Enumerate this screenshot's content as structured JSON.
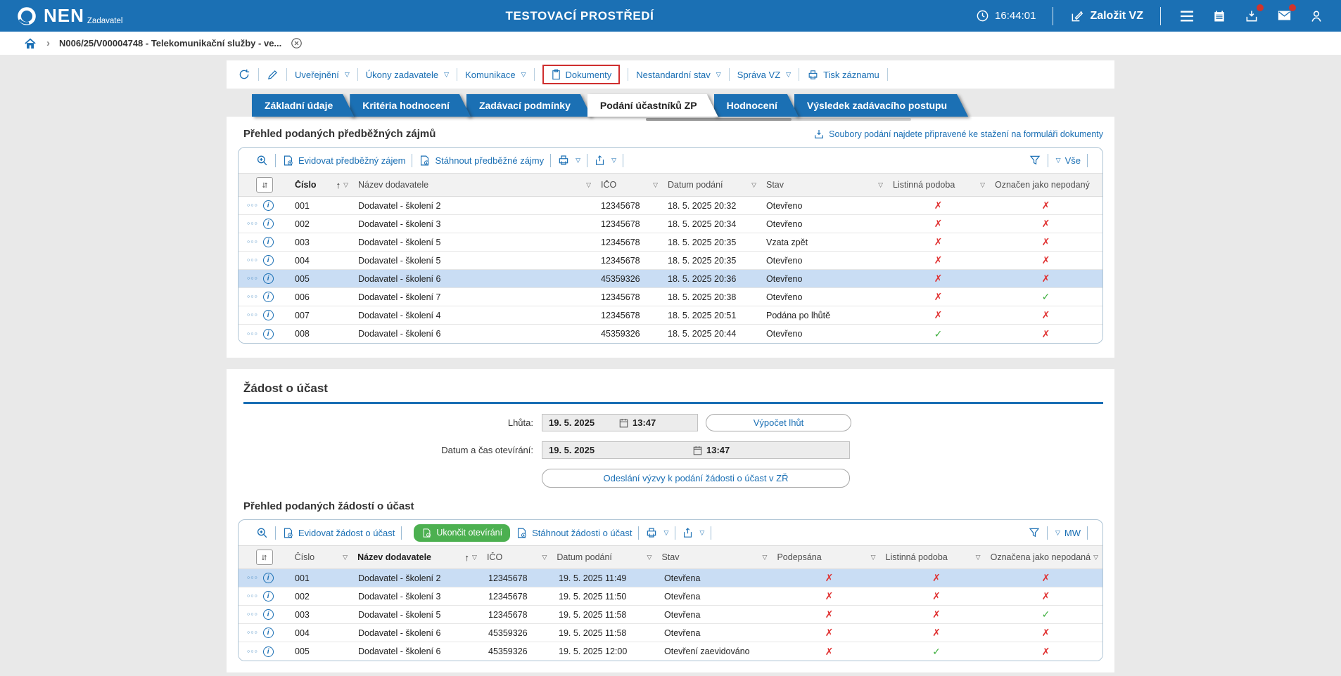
{
  "topbar": {
    "brand": "NEN",
    "brand_sub": "Zadavatel",
    "title": "TESTOVACÍ PROSTŘEDÍ",
    "time": "16:44:01",
    "create_vz": "Založit VZ"
  },
  "breadcrumb": {
    "item": "N006/25/V00004748 - Telekomunikační služby - ve..."
  },
  "action_bar": {
    "uverejneni": "Uveřejnění",
    "ukony_zadavatele": "Úkony zadavatele",
    "komunikace": "Komunikace",
    "dokumenty": "Dokumenty",
    "nestandardni_stav": "Nestandardní stav",
    "sprava_vz": "Správa VZ",
    "tisk_zaznamu": "Tisk záznamu"
  },
  "tabs": [
    {
      "label": "Základní údaje"
    },
    {
      "label": "Kritéria hodnocení"
    },
    {
      "label": "Zadávací podmínky"
    },
    {
      "label": "Podání účastníků ZP",
      "active": true
    },
    {
      "label": "Hodnocení"
    },
    {
      "label": "Výsledek zadávacího postupu"
    }
  ],
  "section1": {
    "title": "Přehled podaných předběžných zájmů",
    "download_note": "Soubory podání najdete připravené ke stažení na formuláři dokumenty",
    "toolbar": {
      "evidovat": "Evidovat předběžný zájem",
      "stahnout": "Stáhnout předběžné zájmy",
      "filter_value": "Vše"
    },
    "table": {
      "columns": [
        "Číslo",
        "Název dodavatele",
        "IČO",
        "Datum podání",
        "Stav",
        "Listinná podoba",
        "Označen jako nepodaný"
      ],
      "rows": [
        {
          "cislo": "001",
          "nazev": "Dodavatel - školení 2",
          "ico": "12345678",
          "datum": "18. 5. 2025 20:32",
          "stav": "Otevřeno",
          "listinna": false,
          "nepodana": false
        },
        {
          "cislo": "002",
          "nazev": "Dodavatel - školení 3",
          "ico": "12345678",
          "datum": "18. 5. 2025 20:34",
          "stav": "Otevřeno",
          "listinna": false,
          "nepodana": false
        },
        {
          "cislo": "003",
          "nazev": "Dodavatel - školení 5",
          "ico": "12345678",
          "datum": "18. 5. 2025 20:35",
          "stav": "Vzata zpět",
          "listinna": false,
          "nepodana": false
        },
        {
          "cislo": "004",
          "nazev": "Dodavatel - školení 5",
          "ico": "12345678",
          "datum": "18. 5. 2025 20:35",
          "stav": "Otevřeno",
          "listinna": false,
          "nepodana": false
        },
        {
          "cislo": "005",
          "nazev": "Dodavatel - školení 6",
          "ico": "45359326",
          "datum": "18. 5. 2025 20:36",
          "stav": "Otevřeno",
          "listinna": false,
          "nepodana": false,
          "selected": true
        },
        {
          "cislo": "006",
          "nazev": "Dodavatel - školení 7",
          "ico": "12345678",
          "datum": "18. 5. 2025 20:38",
          "stav": "Otevřeno",
          "listinna": false,
          "nepodana": true
        },
        {
          "cislo": "007",
          "nazev": "Dodavatel - školení 4",
          "ico": "12345678",
          "datum": "18. 5. 2025 20:51",
          "stav": "Podána po lhůtě",
          "listinna": false,
          "nepodana": false
        },
        {
          "cislo": "008",
          "nazev": "Dodavatel - školení 6",
          "ico": "45359326",
          "datum": "18. 5. 2025 20:44",
          "stav": "Otevřeno",
          "listinna": true,
          "nepodana": false
        }
      ]
    }
  },
  "zadost": {
    "title": "Žádost o účast",
    "lhuta_label": "Lhůta:",
    "lhuta_date": "19. 5. 2025",
    "lhuta_time": "13:47",
    "vypocet_lhut": "Výpočet lhůt",
    "otevirani_label": "Datum a čas otevírání:",
    "otevirani_date": "19. 5. 2025",
    "otevirani_time": "13:47",
    "odeslani_vyzvy": "Odeslání výzvy k podání žádosti o účast v ZŘ"
  },
  "section2": {
    "title": "Přehled podaných žádostí o účast",
    "toolbar": {
      "evidovat": "Evidovat žádost o účast",
      "ukoncit": "Ukončit otevírání",
      "stahnout": "Stáhnout žádosti o účast",
      "filter_value": "MW"
    },
    "table": {
      "columns": [
        "Číslo",
        "Název dodavatele",
        "IČO",
        "Datum podání",
        "Stav",
        "Podepsána",
        "Listinná podoba",
        "Označena jako nepodaná"
      ],
      "rows": [
        {
          "cislo": "001",
          "nazev": "Dodavatel - školení 2",
          "ico": "12345678",
          "datum": "19. 5. 2025 11:49",
          "stav": "Otevřena",
          "podepsana": false,
          "listinna": false,
          "nepodana": false,
          "selected": true
        },
        {
          "cislo": "002",
          "nazev": "Dodavatel - školení 3",
          "ico": "12345678",
          "datum": "19. 5. 2025 11:50",
          "stav": "Otevřena",
          "podepsana": false,
          "listinna": false,
          "nepodana": false
        },
        {
          "cislo": "003",
          "nazev": "Dodavatel - školení 5",
          "ico": "12345678",
          "datum": "19. 5. 2025 11:58",
          "stav": "Otevřena",
          "podepsana": false,
          "listinna": false,
          "nepodana": true
        },
        {
          "cislo": "004",
          "nazev": "Dodavatel - školení 6",
          "ico": "45359326",
          "datum": "19. 5. 2025 11:58",
          "stav": "Otevřena",
          "podepsana": false,
          "listinna": false,
          "nepodana": false
        },
        {
          "cislo": "005",
          "nazev": "Dodavatel - školení 6",
          "ico": "45359326",
          "datum": "19. 5. 2025 12:00",
          "stav": "Otevření zaevidováno",
          "podepsana": false,
          "listinna": true,
          "nepodana": false
        }
      ]
    }
  },
  "icons": {
    "check": "✓",
    "cross": "✗",
    "dropdown": "▽",
    "sort_asc": "↑",
    "row_menu": "○○○",
    "info": "i",
    "breadcrumb_separator": "›"
  },
  "colors": {
    "primary_blue": "#1b70b4",
    "link_blue": "#1a6fb4",
    "highlight_red": "#cf2e2e",
    "badge_red": "#d0342c",
    "success_green": "#4cb050",
    "check_green": "#3cae3c",
    "cross_red": "#e03131",
    "row_selected": "#c9ddf4"
  }
}
